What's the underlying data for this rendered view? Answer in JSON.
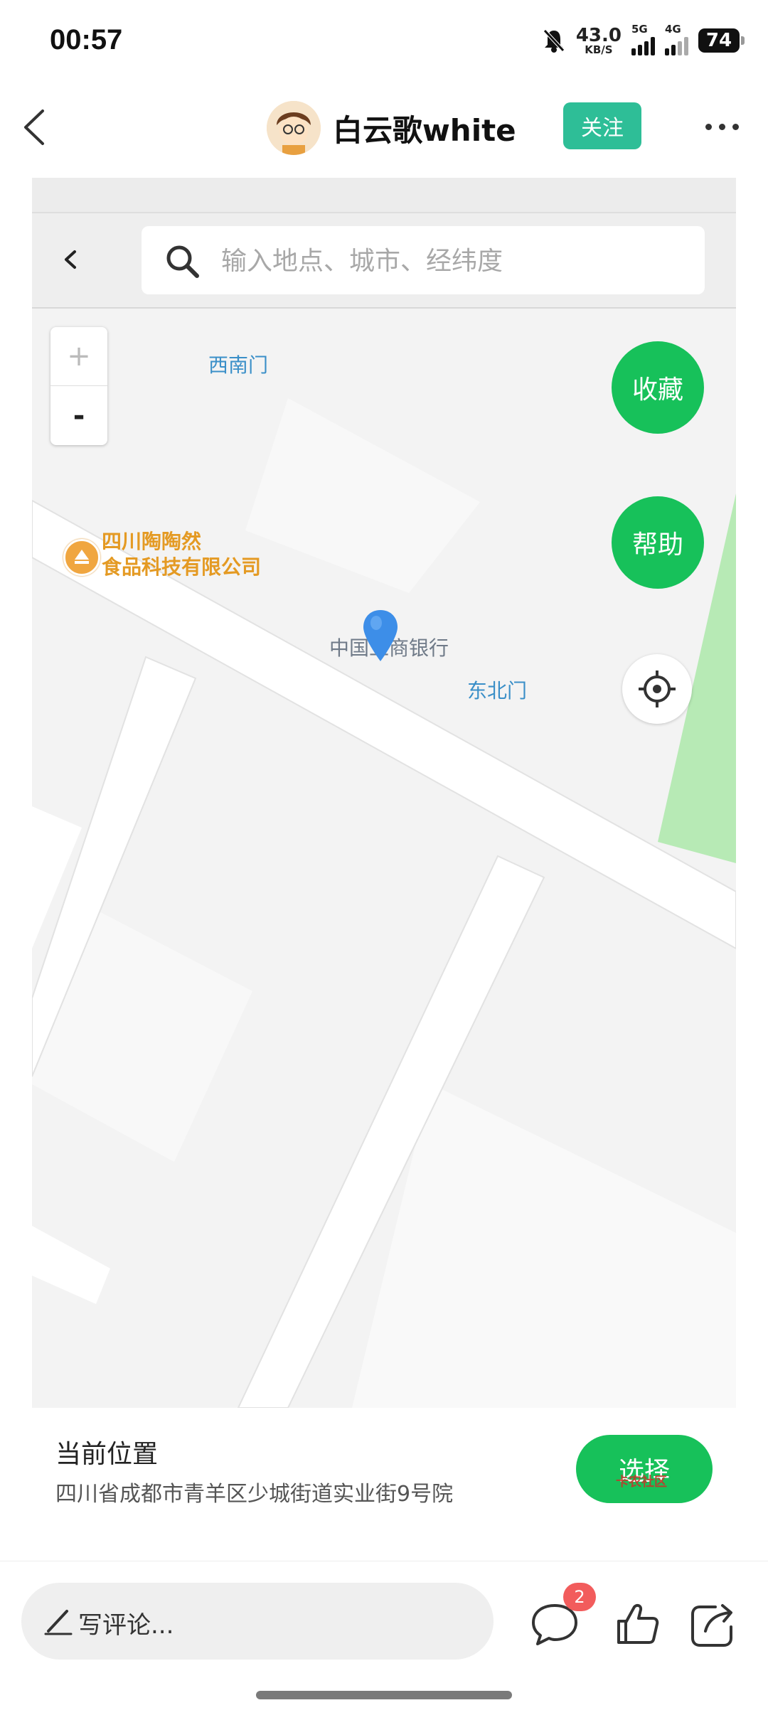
{
  "status_bar": {
    "time": "00:57",
    "net_speed": "43.0",
    "net_unit": "KB/S",
    "sig1_label": "5G",
    "sig2_label": "4G",
    "battery": "74"
  },
  "header": {
    "username": "白云歌white",
    "follow_label": "关注"
  },
  "map": {
    "search_placeholder": "输入地点、城市、经纬度",
    "zoom_in": "+",
    "zoom_out": "-",
    "favorite_label": "收藏",
    "help_label": "帮助",
    "labels": {
      "southwest_gate": "西南门",
      "northeast_gate": "东北门",
      "bank": "中国工商银行",
      "poi_line1": "四川陶陶然",
      "poi_line2": "食品科技有限公司"
    },
    "colors": {
      "road": "#ffffff",
      "ground": "#f3f3f3",
      "block": "#f8f8f8",
      "park": "#b7eab5",
      "marker": "#3d8ee8"
    }
  },
  "location": {
    "title": "当前位置",
    "address": "四川省成都市青羊区少城街道实业街9号院",
    "select_label": "选择",
    "watermark": "卡农社区"
  },
  "comment_bar": {
    "placeholder": "写评论...",
    "badge": "2"
  },
  "accent_colors": {
    "green": "#17c15a",
    "teal": "#2ebe97",
    "badge_red": "#f25c5c"
  }
}
